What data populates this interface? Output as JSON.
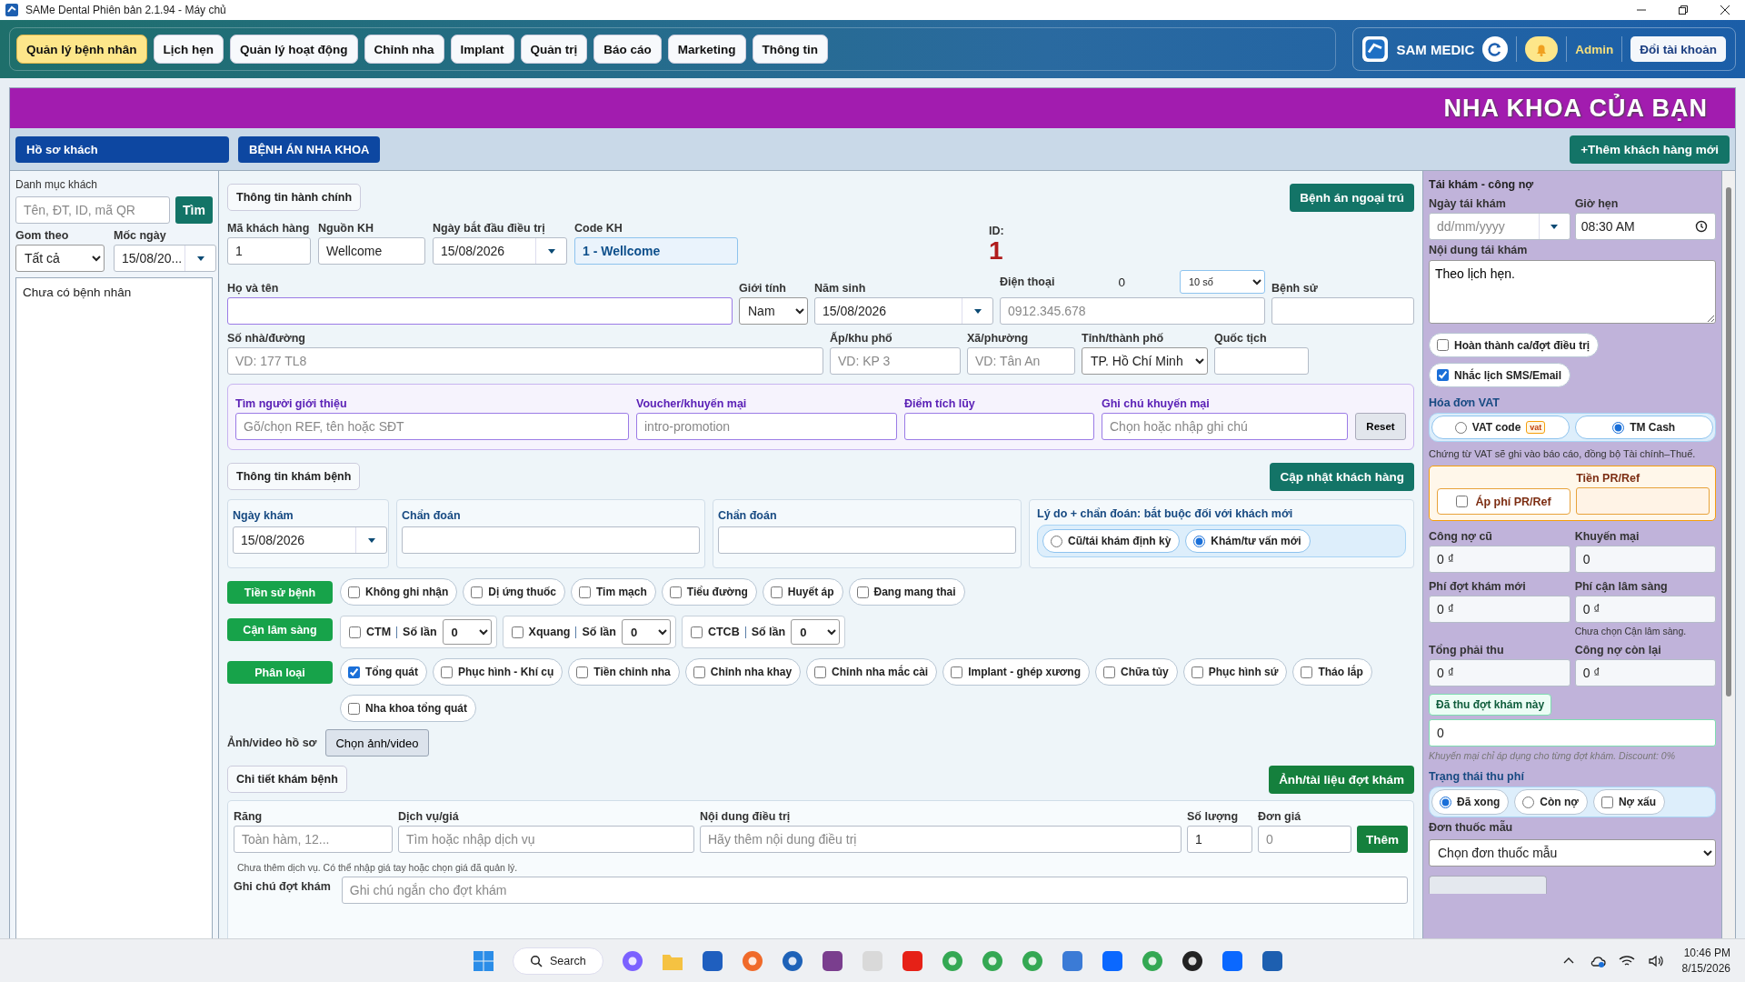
{
  "window": {
    "title": "SAMe Dental Phiên bản 2.1.94 - Máy chủ"
  },
  "nav": {
    "tabs": [
      {
        "label": "Quản lý bệnh nhân",
        "selected": true
      },
      {
        "label": "Lịch hẹn",
        "selected": false
      },
      {
        "label": "Quản lý hoạt động",
        "selected": false
      },
      {
        "label": "Chỉnh nha",
        "selected": false
      },
      {
        "label": "Implant",
        "selected": false
      },
      {
        "label": "Quản trị",
        "selected": false
      },
      {
        "label": "Báo cáo",
        "selected": false
      },
      {
        "label": "Marketing",
        "selected": false
      },
      {
        "label": "Thông tin",
        "selected": false
      }
    ],
    "brand": "SAM MEDIC",
    "user": "Admin",
    "switch_account": "Đổi tài khoản"
  },
  "banner": "NHA KHOA CỦA BẠN",
  "toolbar": {
    "buttons": [
      "Hồ sơ khách",
      "BỆNH ÁN NHA KHOA"
    ],
    "add_button": "+Thêm khách hàng mới"
  },
  "sidebar": {
    "title": "Danh mục khách",
    "search": {
      "placeholder": "Tên, ĐT, ID, mã QR"
    },
    "search_button": "Tìm",
    "group_label": "Gom theo",
    "group_value": "Tất cả",
    "date_label": "Mốc ngày",
    "date_value": "15/08/20...",
    "empty": "Chưa có bệnh nhân"
  },
  "admin": {
    "section": "Thông tin hành chính",
    "outpatient_button": "Bệnh án ngoại trú",
    "row1": [
      {
        "label": "Mã khách hàng",
        "kind": "input",
        "value": "1"
      },
      {
        "label": "Nguồn KH",
        "kind": "input",
        "value": "Wellcome"
      },
      {
        "label": "Ngày bắt đầu điều trị",
        "kind": "date",
        "value": "15/08/2026"
      },
      {
        "label": "Code KH",
        "kind": "code",
        "value": "1 - Wellcome"
      }
    ],
    "id_label": "ID:",
    "id_value": "1",
    "name": {
      "label": "Họ và tên"
    },
    "gender": {
      "label": "Giới tính",
      "value": "Nam"
    },
    "birth": {
      "label": "Năm sinh",
      "value": "15/08/2026"
    },
    "phone": {
      "label": "Điện thoại",
      "count": "0",
      "digits": "10 số",
      "placeholder": "0912.345.678"
    },
    "history": {
      "label": "Bệnh sử"
    },
    "row3": [
      {
        "label": "Số nhà/đường",
        "kind": "input",
        "placeholder": "VD: 177 TL8"
      },
      {
        "label": "Ấp/khu phố",
        "kind": "input",
        "placeholder": "VD: KP 3"
      },
      {
        "label": "Xã/phường",
        "kind": "input",
        "placeholder": "VD: Tân An"
      },
      {
        "label": "Tỉnh/thành phố",
        "kind": "select",
        "value": "TP. Hồ Chí Minh"
      },
      {
        "label": "Quốc tịch",
        "kind": "input"
      }
    ]
  },
  "referral": {
    "fields": [
      {
        "label": "Tìm người giới thiệu",
        "placeholder": "Gõ/chọn REF, tên hoặc SĐT"
      },
      {
        "label": "Voucher/khuyến mại",
        "placeholder": "intro-promotion"
      },
      {
        "label": "Điểm tích lũy"
      },
      {
        "label": "Ghi chú khuyến mại",
        "placeholder": "Chọn hoặc nhập ghi chú"
      }
    ],
    "reset_button": "Reset"
  },
  "exam": {
    "section": "Thông tin khám bệnh",
    "update_button": "Cập nhật khách hàng",
    "date_label": "Ngày khám",
    "date_value": "15/08/2026",
    "diagnosis_labels": [
      "Chẩn đoán",
      "Chẩn đoán"
    ],
    "reason_title": "Lý do + chẩn đoán: bắt buộc đối với khách mới",
    "reasons": [
      {
        "label": "Cũ/tái khám định kỳ",
        "selected": false
      },
      {
        "label": "Khám/tư vấn mới",
        "selected": true
      }
    ]
  },
  "medical_history": {
    "label": "Tiền sử bệnh",
    "items": [
      {
        "label": "Không ghi nhận",
        "checked": false
      },
      {
        "label": "Dị ứng thuốc",
        "checked": false
      },
      {
        "label": "Tim mạch",
        "checked": false
      },
      {
        "label": "Tiểu đường",
        "checked": false
      },
      {
        "label": "Huyết áp",
        "checked": false
      },
      {
        "label": "Đang mang thai",
        "checked": false
      }
    ]
  },
  "paraclinical": {
    "label": "Cận lâm sàng",
    "items": [
      {
        "label": "CTM",
        "checked": false,
        "count_label": "Số lần",
        "count": "0"
      },
      {
        "label": "Xquang",
        "checked": false,
        "count_label": "Số lần",
        "count": "0"
      },
      {
        "label": "CTCB",
        "checked": false,
        "count_label": "Số lần",
        "count": "0"
      }
    ]
  },
  "classification": {
    "label": "Phân loại",
    "items": [
      {
        "label": "Tổng quát",
        "checked": true
      },
      {
        "label": "Phục hình - Khí cụ",
        "checked": false
      },
      {
        "label": "Tiền chỉnh nha",
        "checked": false
      },
      {
        "label": "Chỉnh nha khay",
        "checked": false
      },
      {
        "label": "Chỉnh nha mắc cài",
        "checked": false
      },
      {
        "label": "Implant - ghép xương",
        "checked": false
      },
      {
        "label": "Chữa tủy",
        "checked": false
      },
      {
        "label": "Phục hình sứ",
        "checked": false
      },
      {
        "label": "Tháo lắp",
        "checked": false
      },
      {
        "label": "Nha khoa tổng quát",
        "checked": false
      }
    ]
  },
  "media": {
    "label": "Ảnh/video hồ sơ",
    "button": "Chọn ảnh/video"
  },
  "detail": {
    "section": "Chi tiết khám bệnh",
    "docs_button": "Ảnh/tài liệu đợt khám",
    "fields": [
      {
        "label": "Răng",
        "placeholder": "Toàn hàm, 12..."
      },
      {
        "label": "Dịch vụ/giá",
        "placeholder": "Tìm hoặc nhập dịch vụ"
      },
      {
        "label": "Nội dung điều trị",
        "placeholder": "Hãy thêm nội dung điều trị"
      },
      {
        "label": "Số lượng",
        "value": "1"
      },
      {
        "label": "Đơn giá",
        "placeholder": "0"
      }
    ],
    "add_button": "Thêm",
    "hint": "Chưa thêm dịch vụ. Có thể nhập giá tay hoặc chọn giá đã quản lý.",
    "note_label": "Ghi chú đợt khám",
    "note_placeholder": "Ghi chú ngắn cho đợt khám"
  },
  "followup": {
    "title": "Tái khám - công nợ",
    "date_label": "Ngày tái khám",
    "date_placeholder": "dd/mm/yyyy",
    "time_label": "Giờ hẹn",
    "time_value": "08:30 AM",
    "content_label": "Nội dung tái khám",
    "content_value": "Theo lịch hẹn.",
    "options": [
      {
        "label": "Hoàn thành ca/đợt điều trị",
        "checked": false
      },
      {
        "label": "Nhắc lịch SMS/Email",
        "checked": true
      }
    ],
    "vat_title": "Hóa đơn VAT",
    "vat_options": [
      {
        "label": "VAT code",
        "badge": "vat",
        "selected": false
      },
      {
        "label": "TM Cash",
        "selected": true
      }
    ],
    "vat_note": "Chứng từ VAT sẽ ghi vào báo cáo, đồng bộ Tài chính–Thuế.",
    "pr": {
      "label": "Áp phí PR/Ref",
      "checked": false,
      "amount_label": "Tiền PR/Ref"
    },
    "money": [
      {
        "label": "Công nợ cũ",
        "value": "0 ₫"
      },
      {
        "label": "Khuyến mại",
        "value": "0"
      },
      {
        "label": "Phí đợt khám mới",
        "value": "0 ₫"
      },
      {
        "label": "Phí cận lâm sàng",
        "value": "0 ₫",
        "note": "Chưa chọn Cận lâm sàng."
      },
      {
        "label": "Tổng phải thu",
        "value": "0 ₫"
      },
      {
        "label": "Công nợ còn lại",
        "value": "0 ₫"
      }
    ],
    "paid_label": "Đã thu đợt khám này",
    "paid_value": "0",
    "discount_note": "Khuyến mại chỉ áp dụng cho từng đợt khám. Discount: 0%",
    "status_title": "Trạng thái thu phí",
    "statuses": [
      {
        "label": "Đã xong",
        "kind": "radio",
        "on": true
      },
      {
        "label": "Còn nợ",
        "kind": "radio",
        "on": false
      },
      {
        "label": "Nợ xấu",
        "kind": "checkbox",
        "on": false
      }
    ],
    "prescription_label": "Đơn thuốc mẫu",
    "prescription_value": "Chọn đơn thuốc mẫu"
  },
  "taskbar": {
    "search": "Search",
    "time": "10:46 PM",
    "date": "8/15/2026"
  }
}
